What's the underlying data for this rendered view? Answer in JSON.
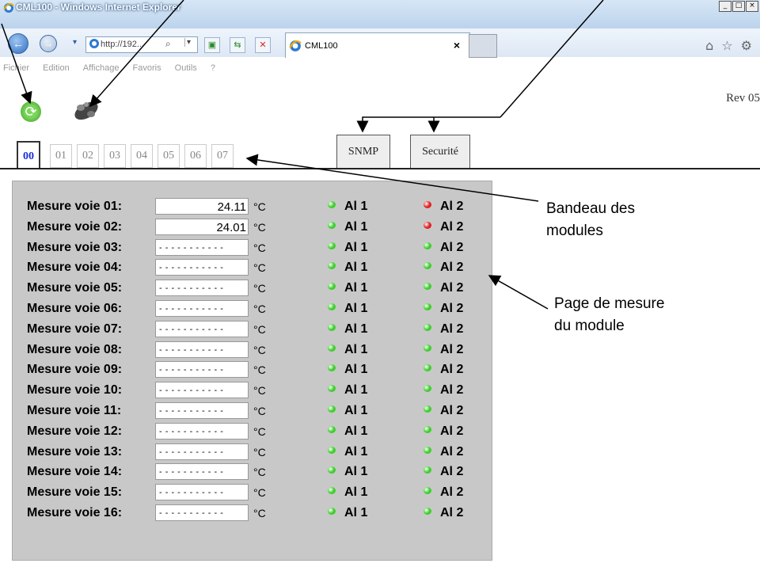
{
  "window": {
    "title": "CML100 - Windows Internet Explorer",
    "controls": [
      "_",
      "□",
      "×"
    ]
  },
  "nav": {
    "back_glyph": "←",
    "forward_glyph": "→",
    "address": "http://192...",
    "search_glyph": "⌕",
    "dropdown_glyph": "▾",
    "tab_title": "CML100",
    "tab_close": "×",
    "right_icons": "⌂☆⚙"
  },
  "menubar": [
    "Fichier",
    "Edition",
    "Affichage",
    "Favoris",
    "Outils",
    "?"
  ],
  "page": {
    "rev": "Rev 05",
    "refresh_glyph": "⟳"
  },
  "module_tabs": [
    "00",
    "01",
    "02",
    "03",
    "04",
    "05",
    "06",
    "07"
  ],
  "section_tabs": [
    "SNMP",
    "Securité"
  ],
  "measurements": [
    {
      "label": "Mesure voie 01:",
      "value": "24.11",
      "unit": "°C",
      "al1": "Al 1",
      "al1_color": "#3ccf2a",
      "al2": "Al 2",
      "al2_color": "#e02020"
    },
    {
      "label": "Mesure voie 02:",
      "value": "24.01",
      "unit": "°C",
      "al1": "Al 1",
      "al1_color": "#3ccf2a",
      "al2": "Al 2",
      "al2_color": "#e02020"
    },
    {
      "label": "Mesure voie 03:",
      "value": "- - - - - - - - - - -",
      "unit": "°C",
      "al1": "Al 1",
      "al1_color": "#3ccf2a",
      "al2": "Al 2",
      "al2_color": "#3ccf2a"
    },
    {
      "label": "Mesure voie 04:",
      "value": "- - - - - - - - - - -",
      "unit": "°C",
      "al1": "Al 1",
      "al1_color": "#3ccf2a",
      "al2": "Al 2",
      "al2_color": "#3ccf2a"
    },
    {
      "label": "Mesure voie 05:",
      "value": "- - - - - - - - - - -",
      "unit": "°C",
      "al1": "Al 1",
      "al1_color": "#3ccf2a",
      "al2": "Al 2",
      "al2_color": "#3ccf2a"
    },
    {
      "label": "Mesure voie 06:",
      "value": "- - - - - - - - - - -",
      "unit": "°C",
      "al1": "Al 1",
      "al1_color": "#3ccf2a",
      "al2": "Al 2",
      "al2_color": "#3ccf2a"
    },
    {
      "label": "Mesure voie 07:",
      "value": "- - - - - - - - - - -",
      "unit": "°C",
      "al1": "Al 1",
      "al1_color": "#3ccf2a",
      "al2": "Al 2",
      "al2_color": "#3ccf2a"
    },
    {
      "label": "Mesure voie 08:",
      "value": "- - - - - - - - - - -",
      "unit": "°C",
      "al1": "Al 1",
      "al1_color": "#3ccf2a",
      "al2": "Al 2",
      "al2_color": "#3ccf2a"
    },
    {
      "label": "Mesure voie 09:",
      "value": "- - - - - - - - - - -",
      "unit": "°C",
      "al1": "Al 1",
      "al1_color": "#3ccf2a",
      "al2": "Al 2",
      "al2_color": "#3ccf2a"
    },
    {
      "label": "Mesure voie 10:",
      "value": "- - - - - - - - - - -",
      "unit": "°C",
      "al1": "Al 1",
      "al1_color": "#3ccf2a",
      "al2": "Al 2",
      "al2_color": "#3ccf2a"
    },
    {
      "label": "Mesure voie 11:",
      "value": "- - - - - - - - - - -",
      "unit": "°C",
      "al1": "Al 1",
      "al1_color": "#3ccf2a",
      "al2": "Al 2",
      "al2_color": "#3ccf2a"
    },
    {
      "label": "Mesure voie 12:",
      "value": "- - - - - - - - - - -",
      "unit": "°C",
      "al1": "Al 1",
      "al1_color": "#3ccf2a",
      "al2": "Al 2",
      "al2_color": "#3ccf2a"
    },
    {
      "label": "Mesure voie 13:",
      "value": "- - - - - - - - - - -",
      "unit": "°C",
      "al1": "Al 1",
      "al1_color": "#3ccf2a",
      "al2": "Al 2",
      "al2_color": "#3ccf2a"
    },
    {
      "label": "Mesure voie 14:",
      "value": "- - - - - - - - - - -",
      "unit": "°C",
      "al1": "Al 1",
      "al1_color": "#3ccf2a",
      "al2": "Al 2",
      "al2_color": "#3ccf2a"
    },
    {
      "label": "Mesure voie 15:",
      "value": "- - - - - - - - - - -",
      "unit": "°C",
      "al1": "Al 1",
      "al1_color": "#3ccf2a",
      "al2": "Al 2",
      "al2_color": "#3ccf2a"
    },
    {
      "label": "Mesure voie 16:",
      "value": "- - - - - - - - - - -",
      "unit": "°C",
      "al1": "Al 1",
      "al1_color": "#3ccf2a",
      "al2": "Al 2",
      "al2_color": "#3ccf2a"
    }
  ],
  "annotations": {
    "bandeau_line1": "Bandeau des",
    "bandeau_line2": "modules",
    "page_line1": "Page de mesure",
    "page_line2": "du module"
  }
}
